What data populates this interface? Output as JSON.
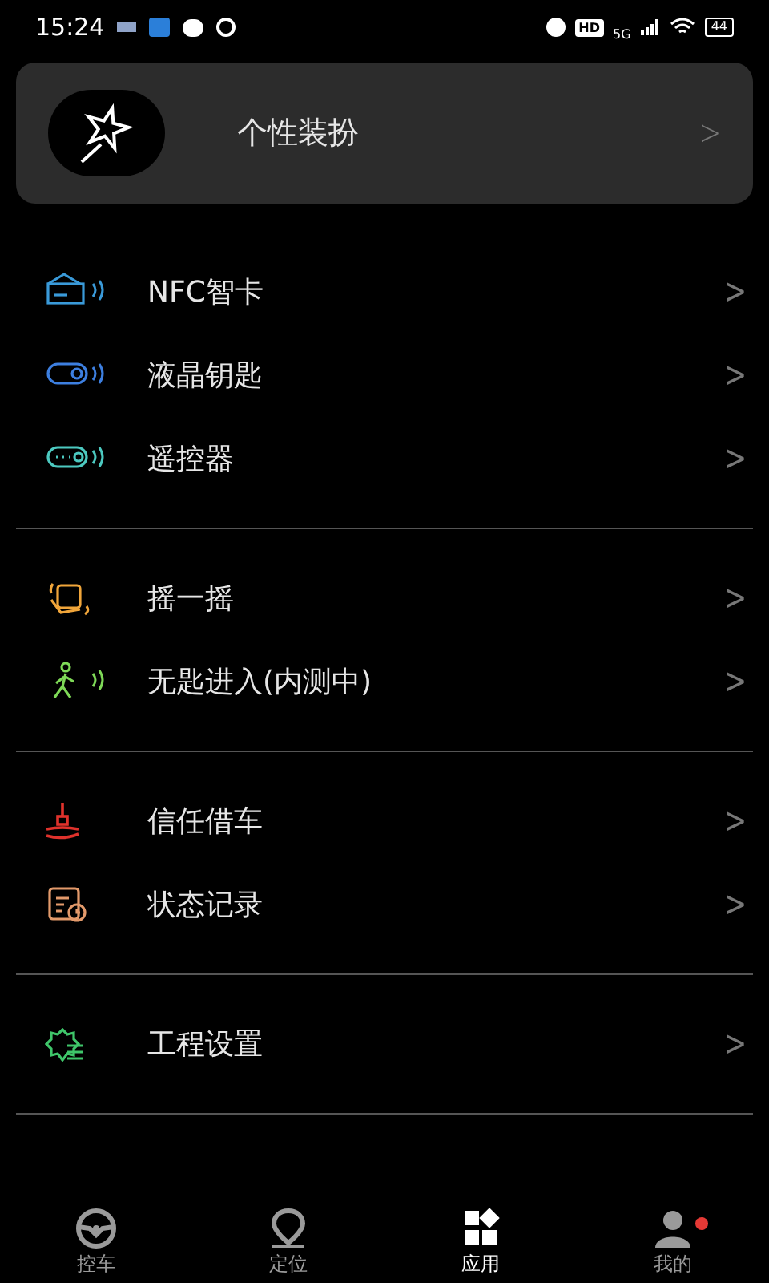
{
  "status_bar": {
    "time": "15:24",
    "hd": "HD",
    "network": "5G",
    "battery": "44"
  },
  "banner": {
    "label": "个性装扮",
    "chevron": ">"
  },
  "groups": [
    {
      "items": [
        {
          "label": "NFC智卡",
          "color": "#3a9ad9",
          "chevron": ">"
        },
        {
          "label": "液晶钥匙",
          "color": "#3d7fe0",
          "chevron": ">"
        },
        {
          "label": "遥控器",
          "color": "#4cc9c0",
          "chevron": ">"
        }
      ]
    },
    {
      "items": [
        {
          "label": "摇一摇",
          "color": "#f0a53a",
          "chevron": ">"
        },
        {
          "label": "无匙进入(内测中)",
          "color": "#7ed957",
          "chevron": ">"
        }
      ]
    },
    {
      "items": [
        {
          "label": "信任借车",
          "color": "#e0322c",
          "chevron": ">"
        },
        {
          "label": "状态记录",
          "color": "#e39a6b",
          "chevron": ">"
        }
      ]
    },
    {
      "items": [
        {
          "label": "工程设置",
          "color": "#3fc66a",
          "chevron": ">"
        }
      ]
    }
  ],
  "tab_bar": [
    {
      "label": "控车",
      "selected": false,
      "badge": false
    },
    {
      "label": "定位",
      "selected": false,
      "badge": false
    },
    {
      "label": "应用",
      "selected": true,
      "badge": false
    },
    {
      "label": "我的",
      "selected": false,
      "badge": true
    }
  ]
}
